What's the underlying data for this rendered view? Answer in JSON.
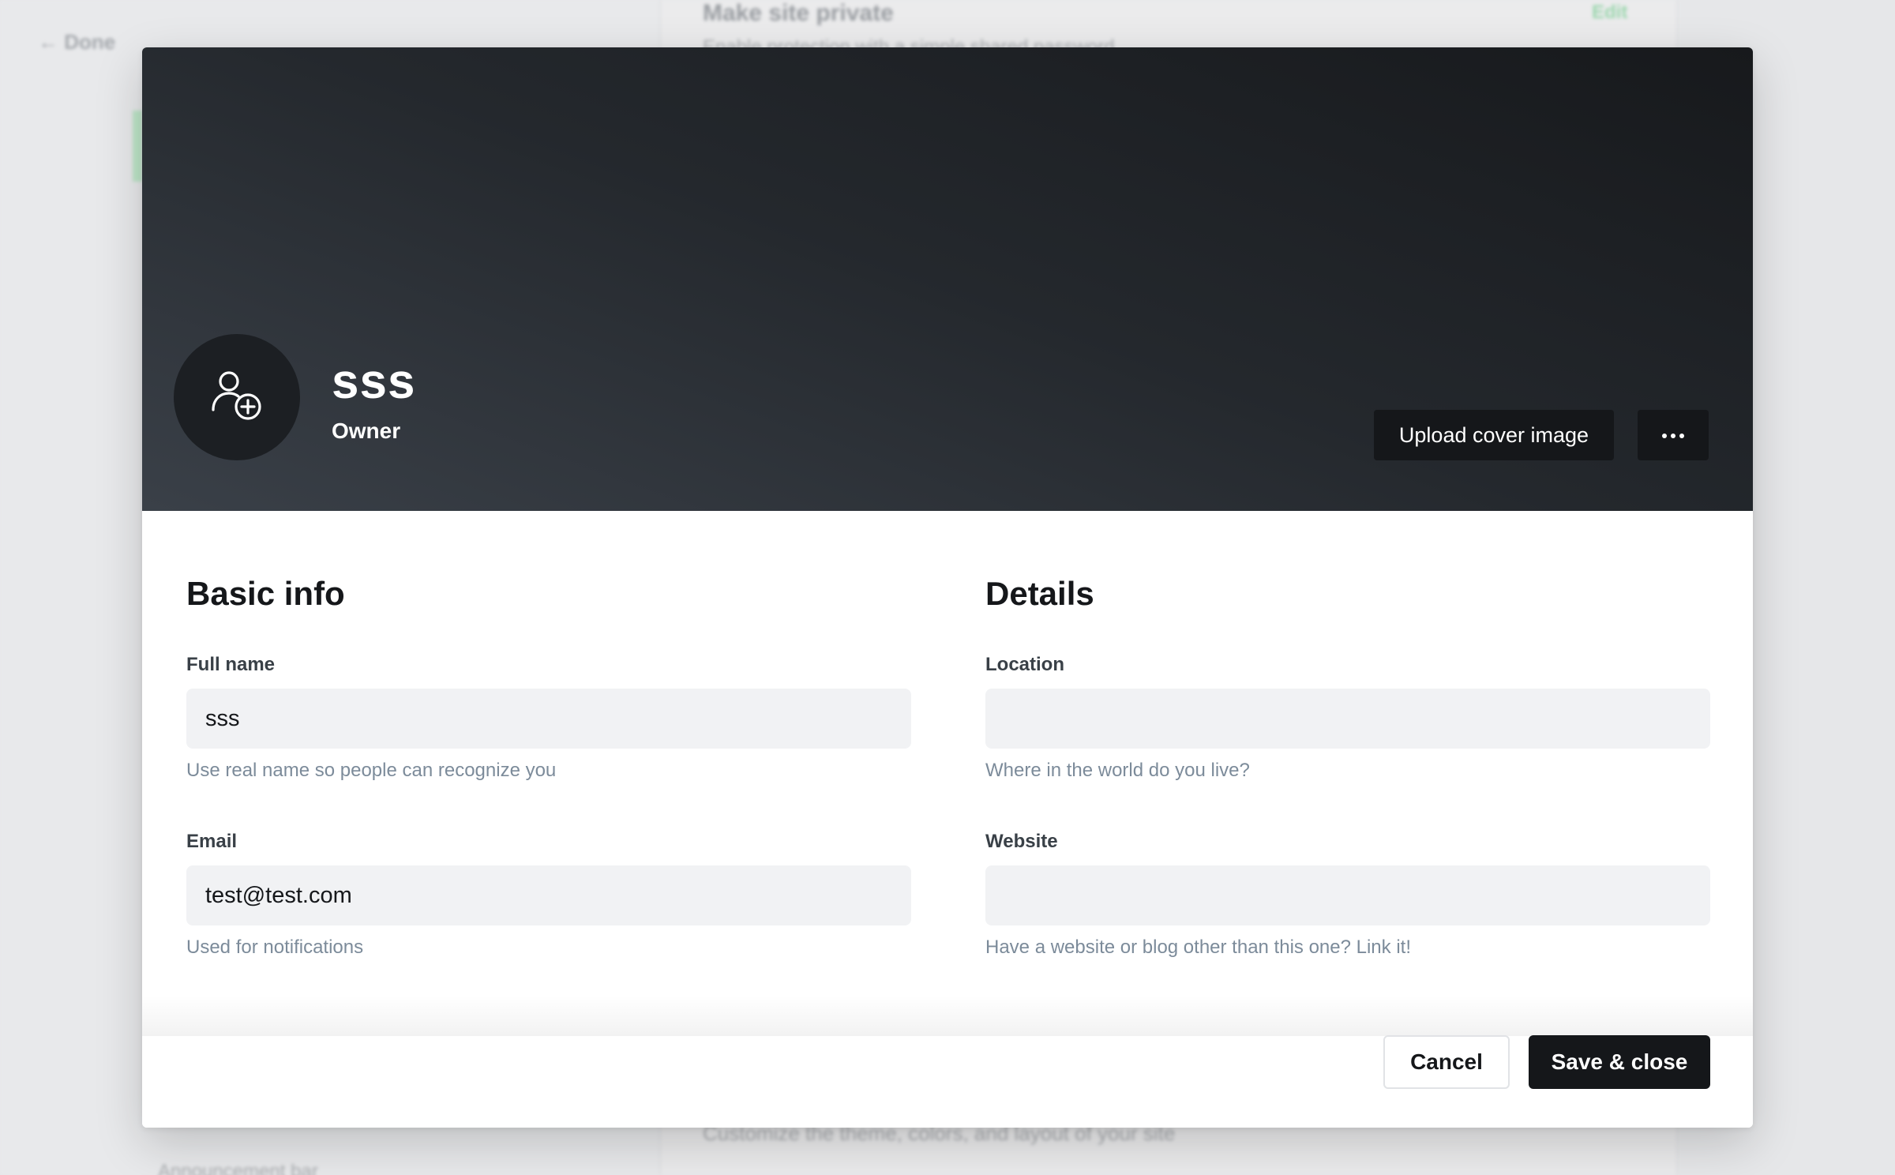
{
  "background": {
    "back_label": "← Done",
    "section_heading": "Make site private",
    "section_sub": "Enable protection with a simple shared password",
    "edit_label": "Edit",
    "footer_text": "Customize the theme, colors, and layout of your site",
    "footer_item": "Announcement bar"
  },
  "profile": {
    "name": "sss",
    "role": "Owner",
    "avatar_icon": "user-add-icon",
    "upload_cover_label": "Upload cover image",
    "more_icon": "ellipsis-icon"
  },
  "basic_info": {
    "title": "Basic info",
    "full_name": {
      "label": "Full name",
      "value": "sss",
      "hint": "Use real name so people can recognize you"
    },
    "email": {
      "label": "Email",
      "value": "test@test.com",
      "hint": "Used for notifications"
    }
  },
  "details": {
    "title": "Details",
    "location": {
      "label": "Location",
      "value": "",
      "hint": "Where in the world do you live?"
    },
    "website": {
      "label": "Website",
      "value": "",
      "hint": "Have a website or blog other than this one? Link it!"
    }
  },
  "footer": {
    "cancel_label": "Cancel",
    "save_label": "Save & close"
  },
  "colors": {
    "primary_button": "#15171a",
    "input_bg": "#f1f2f4",
    "hint_text": "#7c8b9a"
  }
}
